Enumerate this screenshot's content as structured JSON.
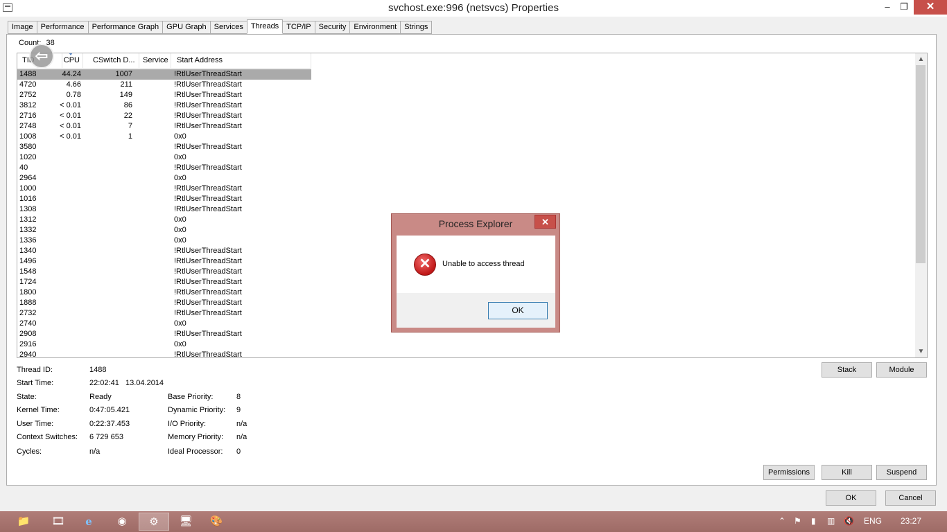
{
  "window": {
    "title": "svchost.exe:996 (netsvcs) Properties",
    "min": "–",
    "max": "❒",
    "close": "✕"
  },
  "tabs": [
    {
      "label": "Image"
    },
    {
      "label": "Performance"
    },
    {
      "label": "Performance Graph"
    },
    {
      "label": "GPU Graph"
    },
    {
      "label": "Services"
    },
    {
      "label": "Threads"
    },
    {
      "label": "TCP/IP"
    },
    {
      "label": "Security"
    },
    {
      "label": "Environment"
    },
    {
      "label": "Strings"
    }
  ],
  "active_tab": "Threads",
  "count": {
    "label": "Count:",
    "value": "38"
  },
  "columns": {
    "tid": "TID",
    "cpu": "CPU",
    "cswitch": "CSwitch D...",
    "service": "Service",
    "start": "Start Address"
  },
  "rows": [
    {
      "tid": "1488",
      "cpu": "44.24",
      "csw": "1007",
      "start": "!RtlUserThreadStart"
    },
    {
      "tid": "4720",
      "cpu": "4.66",
      "csw": "211",
      "start": "!RtlUserThreadStart"
    },
    {
      "tid": "2752",
      "cpu": "0.78",
      "csw": "149",
      "start": "!RtlUserThreadStart"
    },
    {
      "tid": "3812",
      "cpu": "< 0.01",
      "csw": "86",
      "start": "!RtlUserThreadStart"
    },
    {
      "tid": "2716",
      "cpu": "< 0.01",
      "csw": "22",
      "start": "!RtlUserThreadStart"
    },
    {
      "tid": "2748",
      "cpu": "< 0.01",
      "csw": "7",
      "start": "!RtlUserThreadStart"
    },
    {
      "tid": "1008",
      "cpu": "< 0.01",
      "csw": "1",
      "start": "0x0"
    },
    {
      "tid": "3580",
      "cpu": "",
      "csw": "",
      "start": "!RtlUserThreadStart"
    },
    {
      "tid": "1020",
      "cpu": "",
      "csw": "",
      "start": "0x0"
    },
    {
      "tid": "40",
      "cpu": "",
      "csw": "",
      "start": "!RtlUserThreadStart"
    },
    {
      "tid": "2964",
      "cpu": "",
      "csw": "",
      "start": "0x0"
    },
    {
      "tid": "1000",
      "cpu": "",
      "csw": "",
      "start": "!RtlUserThreadStart"
    },
    {
      "tid": "1016",
      "cpu": "",
      "csw": "",
      "start": "!RtlUserThreadStart"
    },
    {
      "tid": "1308",
      "cpu": "",
      "csw": "",
      "start": "!RtlUserThreadStart"
    },
    {
      "tid": "1312",
      "cpu": "",
      "csw": "",
      "start": "0x0"
    },
    {
      "tid": "1332",
      "cpu": "",
      "csw": "",
      "start": "0x0"
    },
    {
      "tid": "1336",
      "cpu": "",
      "csw": "",
      "start": "0x0"
    },
    {
      "tid": "1340",
      "cpu": "",
      "csw": "",
      "start": "!RtlUserThreadStart"
    },
    {
      "tid": "1496",
      "cpu": "",
      "csw": "",
      "start": "!RtlUserThreadStart"
    },
    {
      "tid": "1548",
      "cpu": "",
      "csw": "",
      "start": "!RtlUserThreadStart"
    },
    {
      "tid": "1724",
      "cpu": "",
      "csw": "",
      "start": "!RtlUserThreadStart"
    },
    {
      "tid": "1800",
      "cpu": "",
      "csw": "",
      "start": "!RtlUserThreadStart"
    },
    {
      "tid": "1888",
      "cpu": "",
      "csw": "",
      "start": "!RtlUserThreadStart"
    },
    {
      "tid": "2732",
      "cpu": "",
      "csw": "",
      "start": "!RtlUserThreadStart"
    },
    {
      "tid": "2740",
      "cpu": "",
      "csw": "",
      "start": "0x0"
    },
    {
      "tid": "2908",
      "cpu": "",
      "csw": "",
      "start": "!RtlUserThreadStart"
    },
    {
      "tid": "2916",
      "cpu": "",
      "csw": "",
      "start": "0x0"
    },
    {
      "tid": "2940",
      "cpu": "",
      "csw": "",
      "start": "!RtlUserThreadStart"
    }
  ],
  "selected_row": "1488",
  "details": {
    "thread_id_label": "Thread ID:",
    "thread_id": "1488",
    "start_time_label": "Start Time:",
    "start_time": "22:02:41   13.04.2014",
    "state_label": "State:",
    "state": "Ready",
    "kernel_label": "Kernel Time:",
    "kernel": "0:47:05.421",
    "user_label": "User Time:",
    "user": "0:22:37.453",
    "ctx_label": "Context Switches:",
    "ctx": "6 729 653",
    "cycles_label": "Cycles:",
    "cycles": "n/a",
    "base_label": "Base Priority:",
    "base": "8",
    "dyn_label": "Dynamic Priority:",
    "dyn": "9",
    "io_label": "I/O Priority:",
    "io": "n/a",
    "mem_label": "Memory Priority:",
    "mem": "n/a",
    "ideal_label": "Ideal Processor:",
    "ideal": "0"
  },
  "buttons": {
    "stack": "Stack",
    "module": "Module",
    "permissions": "Permissions",
    "kill": "Kill",
    "suspend": "Suspend",
    "ok": "OK",
    "cancel": "Cancel"
  },
  "dialog": {
    "title": "Process Explorer",
    "close": "✕",
    "message": "Unable to access thread",
    "ok": "OK",
    "icon": "error-icon"
  },
  "taskbar": {
    "apps": [
      {
        "name": "file-explorer-icon",
        "glyph": "📁"
      },
      {
        "name": "media-icon",
        "glyph": "🎞"
      },
      {
        "name": "internet-explorer-icon",
        "glyph": "e"
      },
      {
        "name": "chrome-icon",
        "glyph": "◉"
      },
      {
        "name": "process-explorer-icon",
        "glyph": "⚙"
      },
      {
        "name": "remote-desktop-icon",
        "glyph": "🖥"
      },
      {
        "name": "paint-icon",
        "glyph": "🎨"
      }
    ],
    "lang": "ENG",
    "clock": "23:27"
  },
  "colors": {
    "close_red": "#c7504a",
    "taskbar": "#a8756f",
    "selection": "#aaaaaa",
    "dialog_frame": "#c98a86"
  }
}
